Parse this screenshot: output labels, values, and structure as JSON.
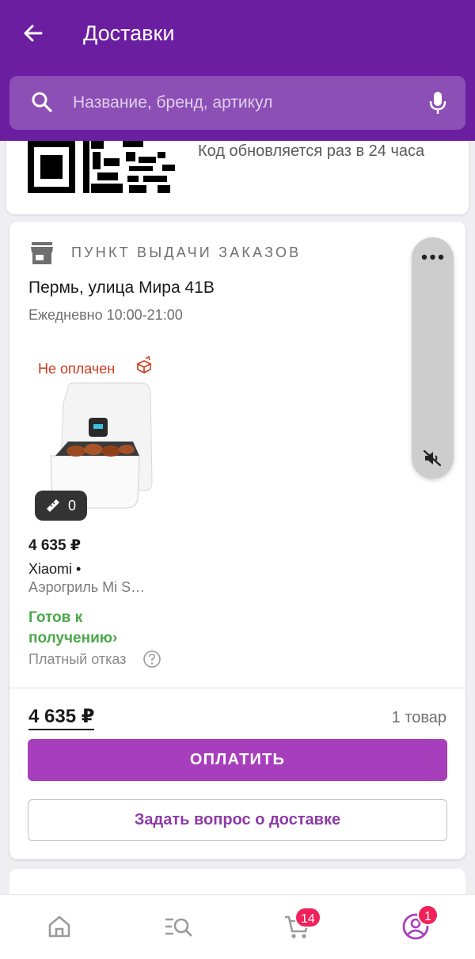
{
  "header": {
    "title": "Доставки",
    "back_icon": "arrow-left-icon"
  },
  "search": {
    "placeholder": "Название, бренд, артикул",
    "value": ""
  },
  "qr_card": {
    "text": "Код обновляется раз в 24 часа"
  },
  "delivery": {
    "pickup_label": "ПУНКТ ВЫДАЧИ ЗАКАЗОВ",
    "address": "Пермь, улица Мира 41В",
    "hours": "Ежедневно 10:00-21:00",
    "product": {
      "payment_status": "Не оплачен",
      "measure_count": "0",
      "price": "4 635 ₽",
      "brand": "Xiaomi •",
      "name": "Аэрогриль Mi S…",
      "status": "Готов к получению›",
      "refusal": "Платный отказ"
    },
    "total": "4 635 ₽",
    "items_count": "1 товар",
    "pay_button": "ОПЛАТИТЬ",
    "ask_button": "Задать вопрос о доставке"
  },
  "bottom_nav": {
    "cart_badge": "14",
    "profile_badge": "1"
  },
  "colors": {
    "header": "#6c1ea0",
    "pay_button": "#a73fbd",
    "status_ready": "#4aa84a",
    "not_paid": "#cc3a1c",
    "badge": "#f0205a"
  }
}
